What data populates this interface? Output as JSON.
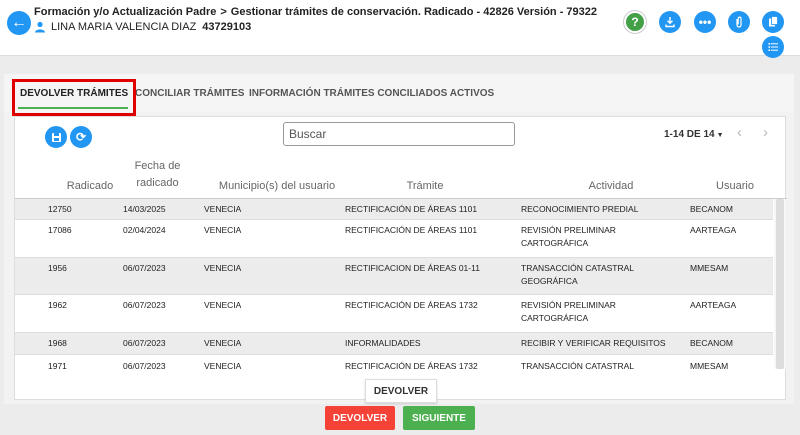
{
  "header": {
    "breadcrumb_parent": "Formación y/o Actualización Padre",
    "breadcrumb_current": "Gestionar trámites de conservación. Radicado - 42826 Versión - 79322",
    "user_name": "LINA MARIA VALENCIA DIAZ",
    "user_id": "43729103",
    "icons": [
      "help-icon",
      "download-icon",
      "more-icon",
      "attachment-icon",
      "documents-icon",
      "list-icon"
    ]
  },
  "tabs": [
    {
      "label": "DEVOLVER TRÁMITES",
      "active": true
    },
    {
      "label": "CONCILIAR TRÁMITES",
      "active": false
    },
    {
      "label": "INFORMACIÓN TRÁMITES CONCILIADOS ACTIVOS",
      "active": false
    }
  ],
  "search": {
    "placeholder": "Buscar"
  },
  "pager": {
    "label": "1-14 DE 14"
  },
  "table": {
    "headers": {
      "radicado": "Radicado",
      "fecha_1": "Fecha de",
      "fecha_2": "radicado",
      "municipio": "Municipio(s) del usuario",
      "tramite": "Trámite",
      "actividad": "Actividad",
      "usuario": "Usuario"
    },
    "rows": [
      {
        "radicado": "12750",
        "fecha": "14/03/2025",
        "municipio": "VENECIA",
        "tramite": "RECTIFICACIÓN DE ÁREAS 1101",
        "actividad_1": "RECONOCIMIENTO PREDIAL",
        "actividad_2": "",
        "usuario": "BECANOM"
      },
      {
        "radicado": "17086",
        "fecha": "02/04/2024",
        "municipio": "VENECIA",
        "tramite": "RECTIFICACIÓN DE ÁREAS 1101",
        "actividad_1": "REVISIÓN PRELIMINAR",
        "actividad_2": "CARTOGRÁFICA",
        "usuario": "AARTEAGA"
      },
      {
        "radicado": "1956",
        "fecha": "06/07/2023",
        "municipio": "VENECIA",
        "tramite": "RECTIFICACION DE ÁREAS 01-11",
        "actividad_1": "TRANSACCIÓN CATASTRAL",
        "actividad_2": "GEOGRÁFICA",
        "usuario": "MMESAM"
      },
      {
        "radicado": "1962",
        "fecha": "06/07/2023",
        "municipio": "VENECIA",
        "tramite": "RECTIFICACIÓN DE ÁREAS 1732",
        "actividad_1": "REVISIÓN PRELIMINAR",
        "actividad_2": "CARTOGRÁFICA",
        "usuario": "AARTEAGA"
      },
      {
        "radicado": "1968",
        "fecha": "06/07/2023",
        "municipio": "VENECIA",
        "tramite": "INFORMALIDADES",
        "actividad_1": "RECIBIR Y VERIFICAR REQUISITOS",
        "actividad_2": "",
        "usuario": "BECANOM"
      },
      {
        "radicado": "1971",
        "fecha": "06/07/2023",
        "municipio": "VENECIA",
        "tramite": "RECTIFICACIÓN DE ÁREAS 1732",
        "actividad_1": "TRANSACCIÓN CATASTRAL",
        "actividad_2": "",
        "usuario": "MMESAM"
      }
    ]
  },
  "buttons": {
    "inner_devolver": "DEVOLVER",
    "devolver": "DEVOLVER",
    "siguiente": "SIGUIENTE"
  },
  "colors": {
    "accent": "#2196f3",
    "danger": "#f44336",
    "success": "#4caf50",
    "highlight": "#e00000"
  }
}
